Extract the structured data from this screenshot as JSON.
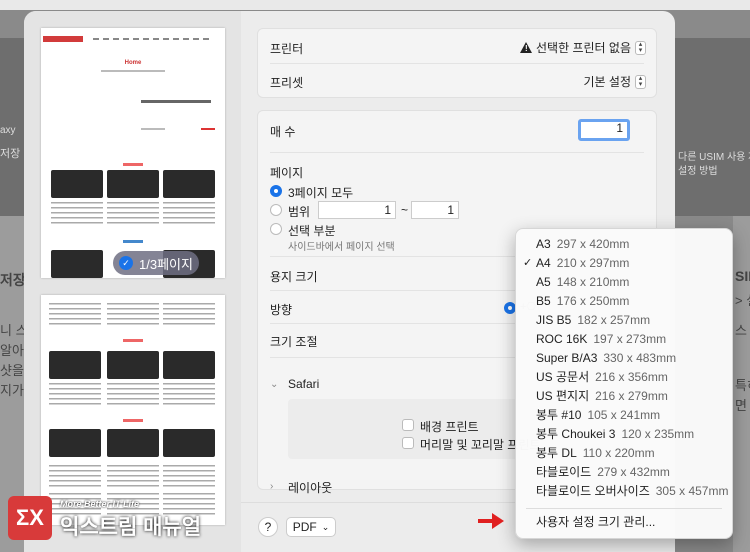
{
  "background": {
    "left_texts": [
      "axy",
      "저장",
      "저장",
      "니 스",
      "알아",
      "샷을",
      "지가"
    ],
    "right_texts": [
      "다른 USIM 사용 제",
      "설정 방법",
      "SIM",
      "> 설",
      "스",
      "특히",
      "면"
    ]
  },
  "preview": {
    "page_badge": "1/3페이지",
    "thumb_home": "Home"
  },
  "printer": {
    "label": "프린터",
    "value": "선택한 프린터 없음",
    "preset_label": "프리셋",
    "preset_value": "기본 설정"
  },
  "copies": {
    "label": "매 수",
    "value": "1"
  },
  "pages": {
    "label": "페이지",
    "all_label": "3페이지 모두",
    "range_label": "범위",
    "range_from": "1",
    "range_sep": "~",
    "range_to": "1",
    "selection_label": "선택 부분",
    "selection_hint": "사이드바에서 페이지 선택"
  },
  "paper": {
    "size_label": "용지 크기",
    "orientation_label": "방향",
    "scale_label": "크기 조절"
  },
  "safari": {
    "label": "Safari",
    "print_backgrounds": "배경 프린트",
    "headers_footers": "머리말 및 꼬리말 프린트"
  },
  "layout_label": "레이아웃",
  "bottom": {
    "help": "?",
    "pdf": "PDF"
  },
  "menu": {
    "items": [
      {
        "name": "A3",
        "size": "297 x 420mm",
        "checked": false
      },
      {
        "name": "A4",
        "size": "210 x 297mm",
        "checked": true
      },
      {
        "name": "A5",
        "size": "148 x 210mm",
        "checked": false
      },
      {
        "name": "B5",
        "size": "176 x 250mm",
        "checked": false
      },
      {
        "name": "JIS B5",
        "size": "182 x 257mm",
        "checked": false
      },
      {
        "name": "ROC 16K",
        "size": "197 x 273mm",
        "checked": false
      },
      {
        "name": "Super B/A3",
        "size": "330 x 483mm",
        "checked": false
      },
      {
        "name": "US 공문서",
        "size": "216 x 356mm",
        "checked": false
      },
      {
        "name": "US 편지지",
        "size": "216 x 279mm",
        "checked": false
      },
      {
        "name": "봉투 #10",
        "size": "105 x 241mm",
        "checked": false
      },
      {
        "name": "봉투 Choukei 3",
        "size": "120 x 235mm",
        "checked": false
      },
      {
        "name": "봉투 DL",
        "size": "110 x 220mm",
        "checked": false
      },
      {
        "name": "타블로이드",
        "size": "279 x 432mm",
        "checked": false
      },
      {
        "name": "타블로이드 오버사이즈",
        "size": "305 x 457mm",
        "checked": false
      }
    ],
    "manage": "사용자 설정 크기 관리..."
  },
  "watermark": {
    "tagline": "More Better IT Life",
    "brand": "익스트림 매뉴얼"
  },
  "colors": {
    "accent": "#1a73e8",
    "arrow": "#e02020",
    "brand": "#d83a3a"
  }
}
